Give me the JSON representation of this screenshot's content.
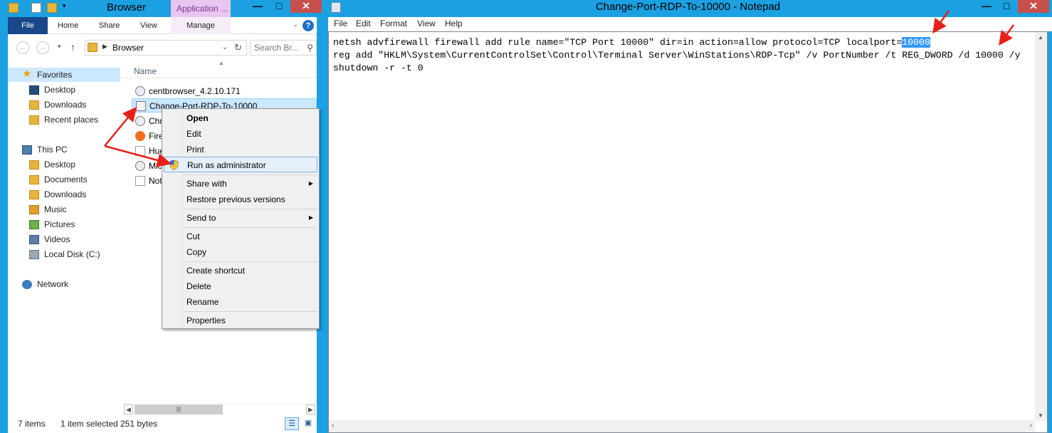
{
  "explorer": {
    "title": "Browser",
    "context_tab": "Application ...",
    "ribbon_tabs": {
      "file": "File",
      "home": "Home",
      "share": "Share",
      "view": "View",
      "manage": "Manage"
    },
    "help": "?",
    "address": {
      "current": "Browser"
    },
    "search": {
      "placeholder": "Search Br..."
    },
    "nav": {
      "favorites": "Favorites",
      "desktop": "Desktop",
      "downloads": "Downloads",
      "recent": "Recent places",
      "this_pc": "This PC",
      "pc_desktop": "Desktop",
      "documents": "Documents",
      "pc_downloads": "Downloads",
      "music": "Music",
      "pictures": "Pictures",
      "videos": "Videos",
      "local_disk": "Local Disk (C:)",
      "network": "Network"
    },
    "column_name": "Name",
    "files": [
      "centbrowser_4.2.10.171",
      "Change-Port-RDP-To-10000",
      "Chr",
      "Fire",
      "Hue",
      "Mic",
      "Not"
    ],
    "status": {
      "items": "7 items",
      "selected": "1 item selected",
      "size": "251 bytes"
    }
  },
  "context_menu": {
    "open": "Open",
    "edit": "Edit",
    "print": "Print",
    "run_as_admin": "Run as administrator",
    "share_with": "Share with",
    "restore": "Restore previous versions",
    "send_to": "Send to",
    "cut": "Cut",
    "copy": "Copy",
    "create_shortcut": "Create shortcut",
    "delete": "Delete",
    "rename": "Rename",
    "properties": "Properties"
  },
  "notepad": {
    "title": "Change-Port-RDP-To-10000 - Notepad",
    "menu": {
      "file": "File",
      "edit": "Edit",
      "format": "Format",
      "view": "View",
      "help": "Help"
    },
    "line1_before": "netsh advfirewall firewall add rule name=\"TCP Port 10000\" dir=in action=allow protocol=TCP localport=",
    "line1_selected": "10000",
    "line2": "reg add \"HKLM\\System\\CurrentControlSet\\Control\\Terminal Server\\WinStations\\RDP-Tcp\" /v PortNumber /t REG_DWORD /d 10000 /y",
    "line3": "shutdown -r -t 0"
  },
  "colors": {
    "window_frame": "#1ba1e2",
    "selection": "#3399ff",
    "annotation_arrow": "#e8201a",
    "file_tab": "#19478a"
  }
}
